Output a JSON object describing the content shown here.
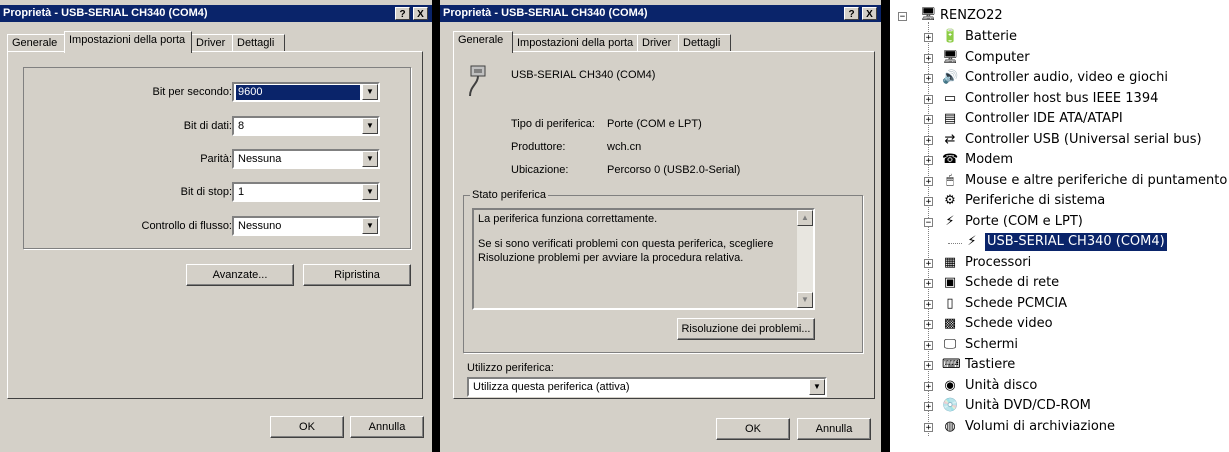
{
  "dialog1": {
    "title": "Proprietà - USB-SERIAL CH340 (COM4)",
    "help_btn": "?",
    "close_btn": "X",
    "tabs": [
      "Generale",
      "Impostazioni della porta",
      "Driver",
      "Dettagli"
    ],
    "fields": [
      {
        "label": "Bit per secondo:",
        "value": "9600"
      },
      {
        "label": "Bit di dati:",
        "value": "8"
      },
      {
        "label": "Parità:",
        "value": "Nessuna"
      },
      {
        "label": "Bit di stop:",
        "value": "1"
      },
      {
        "label": "Controllo di flusso:",
        "value": "Nessuno"
      }
    ],
    "advanced_btn": "Avanzate...",
    "restore_btn": "Ripristina",
    "ok_btn": "OK",
    "cancel_btn": "Annulla"
  },
  "dialog2": {
    "title": "Proprietà - USB-SERIAL CH340 (COM4)",
    "help_btn": "?",
    "close_btn": "X",
    "tabs": [
      "Generale",
      "Impostazioni della porta",
      "Driver",
      "Dettagli"
    ],
    "device_name": "USB-SERIAL CH340 (COM4)",
    "info": [
      {
        "label": "Tipo di periferica:",
        "value": "Porte (COM e LPT)"
      },
      {
        "label": "Produttore:",
        "value": "wch.cn"
      },
      {
        "label": "Ubicazione:",
        "value": "Percorso 0 (USB2.0-Serial)"
      }
    ],
    "status_group": "Stato periferica",
    "status_line1": "La periferica funziona correttamente.",
    "status_line2": "Se si sono verificati problemi con questa periferica, scegliere",
    "status_line3": "Risoluzione problemi per avviare la procedura relativa.",
    "troubleshoot_btn": "Risoluzione dei problemi...",
    "usage_label": "Utilizzo periferica:",
    "usage_value": "Utilizza questa periferica (attiva)",
    "ok_btn": "OK",
    "cancel_btn": "Annulla"
  },
  "device_tree": {
    "root": "RENZO22",
    "items": [
      {
        "label": "Batterie",
        "icon": "battery-icon"
      },
      {
        "label": "Computer",
        "icon": "computer-icon"
      },
      {
        "label": "Controller audio, video e giochi",
        "icon": "audio-icon"
      },
      {
        "label": "Controller host bus IEEE 1394",
        "icon": "ieee1394-icon"
      },
      {
        "label": "Controller IDE ATA/ATAPI",
        "icon": "ide-icon"
      },
      {
        "label": "Controller USB (Universal serial bus)",
        "icon": "usb-icon"
      },
      {
        "label": "Modem",
        "icon": "modem-icon"
      },
      {
        "label": "Mouse e altre periferiche di puntamento",
        "icon": "mouse-icon"
      },
      {
        "label": "Periferiche di sistema",
        "icon": "system-icon"
      },
      {
        "label": "Porte (COM e LPT)",
        "icon": "port-icon"
      },
      {
        "label": "Processori",
        "icon": "cpu-icon"
      },
      {
        "label": "Schede di rete",
        "icon": "network-icon"
      },
      {
        "label": "Schede PCMCIA",
        "icon": "pcmcia-icon"
      },
      {
        "label": "Schede video",
        "icon": "video-card-icon"
      },
      {
        "label": "Schermi",
        "icon": "monitor-icon"
      },
      {
        "label": "Tastiere",
        "icon": "keyboard-icon"
      },
      {
        "label": "Unità disco",
        "icon": "disk-icon"
      },
      {
        "label": "Unità DVD/CD-ROM",
        "icon": "dvd-icon"
      },
      {
        "label": "Volumi di archiviazione",
        "icon": "volume-icon"
      }
    ],
    "selected_child": "USB-SERIAL CH340 (COM4)",
    "colors": {
      "selection": "#0a246a"
    }
  }
}
